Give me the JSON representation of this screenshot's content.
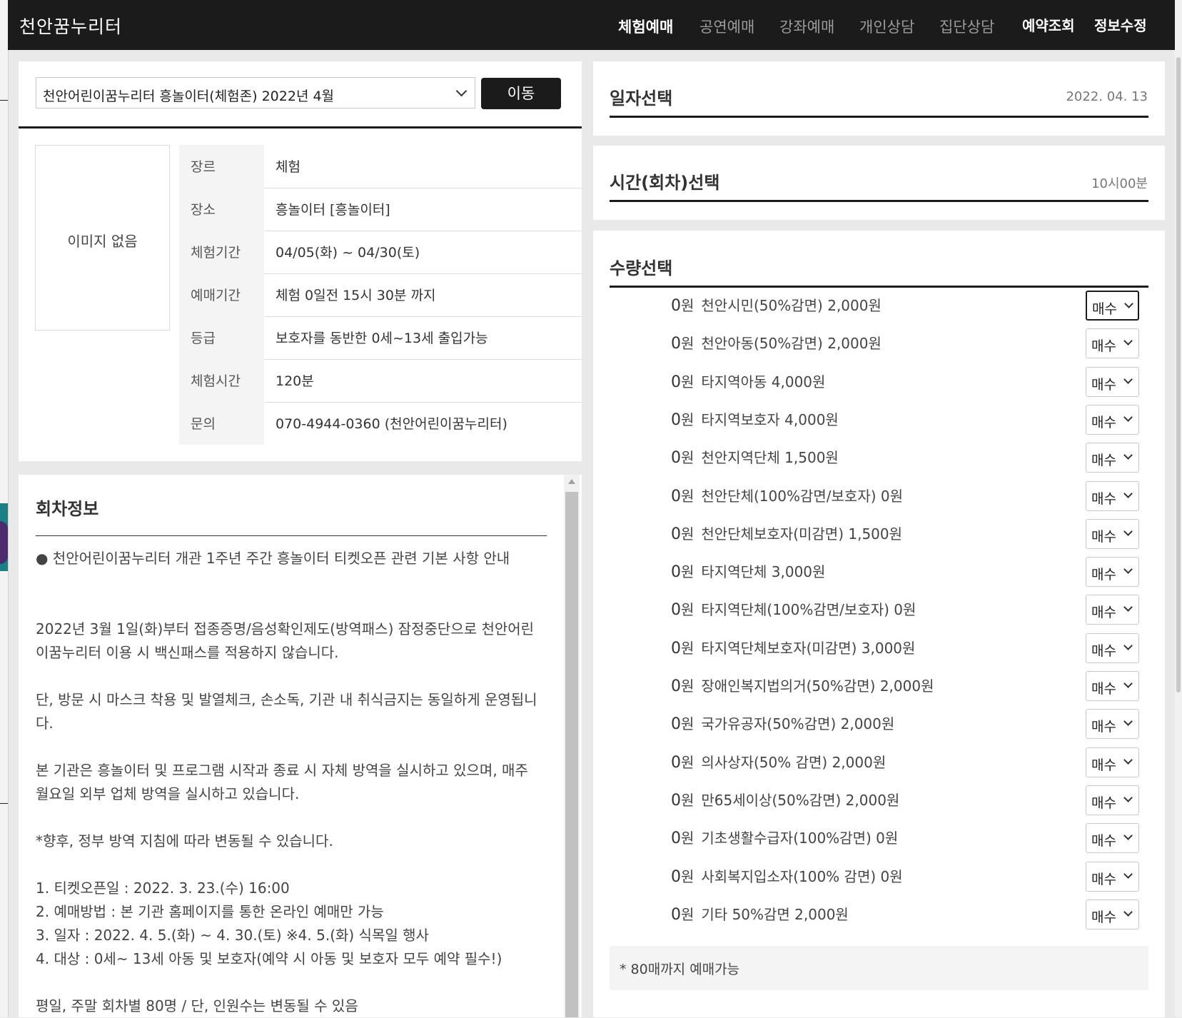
{
  "header": {
    "brand": "천안꿈누리터",
    "nav": [
      "체험예매",
      "공연예매",
      "강좌예매",
      "개인상담",
      "집단상담"
    ],
    "util": [
      "예약조회",
      "정보수정"
    ]
  },
  "program_select": {
    "selected": "천안어린이꿈누리터 흥놀이터(체험존) 2022년 4월",
    "go_label": "이동"
  },
  "no_image": "이미지 없음",
  "info": [
    {
      "label": "장르",
      "value": "체험"
    },
    {
      "label": "장소",
      "value": "흥놀이터 [흥놀이터]"
    },
    {
      "label": "체험기간",
      "value": "04/05(화) ~ 04/30(토)"
    },
    {
      "label": "예매기간",
      "value": "체험 0일전 15시 30분 까지"
    },
    {
      "label": "등급",
      "value": "보호자를 동반한 0세~13세 출입가능"
    },
    {
      "label": "체험시간",
      "value": "120분"
    },
    {
      "label": "문의",
      "value": "070-4944-0360 (천안어린이꿈누리터)"
    }
  ],
  "notice": {
    "title": "회차정보",
    "p1": "● 천안어린이꿈누리터 개관 1주년 주간 흥놀이터 티켓오픈 관련 기본 사항 안내",
    "p2": "2022년 3월 1일(화)부터 접종증명/음성확인제도(방역패스) 잠정중단으로 천안어린이꿈누리터 이용 시 백신패스를 적용하지 않습니다.",
    "p3": "단, 방문 시 마스크 착용 및 발열체크, 손소독, 기관 내 취식금지는 동일하게 운영됩니다.",
    "p4": "본 기관은 흥놀이터 및 프로그램 시작과 종료 시 자체 방역을 실시하고 있으며, 매주 월요일 외부 업체 방역을 실시하고 있습니다.",
    "p5": "*향후, 정부 방역 지침에 따라 변동될 수 있습니다.",
    "l1": "1. 티켓오픈일 : 2022. 3. 23.(수) 16:00",
    "l2": "2. 예매방법 : 본 기관 홈페이지를 통한 온라인 예매만 가능",
    "l3": "3. 일자 : 2022. 4. 5.(화) ~ 4. 30.(토) ※4. 5.(화) 식목일 행사",
    "l4": "4. 대상 : 0세~ 13세 아동 및 보호자(예약 시 아동 및 보호자 모두 예약 필수!)",
    "l5": "평일, 주말 회차별 80명 / 단, 인원수는 변동될 수 있음"
  },
  "date_select": {
    "title": "일자선택",
    "value": "2022. 04. 13"
  },
  "time_select": {
    "title": "시간(회차)선택",
    "value": "10시00분"
  },
  "qty_select": {
    "title": "수량선택",
    "select_label": "매수",
    "tickets": [
      {
        "price": "0",
        "unit": "원",
        "name": "천안시민(50%감면) 2,000원"
      },
      {
        "price": "0",
        "unit": "원",
        "name": "천안아동(50%감면) 2,000원"
      },
      {
        "price": "0",
        "unit": "원",
        "name": "타지역아동 4,000원"
      },
      {
        "price": "0",
        "unit": "원",
        "name": "타지역보호자 4,000원"
      },
      {
        "price": "0",
        "unit": "원",
        "name": "천안지역단체 1,500원"
      },
      {
        "price": "0",
        "unit": "원",
        "name": "천안단체(100%감면/보호자) 0원"
      },
      {
        "price": "0",
        "unit": "원",
        "name": "천안단체보호자(미감면) 1,500원"
      },
      {
        "price": "0",
        "unit": "원",
        "name": "타지역단체 3,000원"
      },
      {
        "price": "0",
        "unit": "원",
        "name": "타지역단체(100%감면/보호자) 0원"
      },
      {
        "price": "0",
        "unit": "원",
        "name": "타지역단체보호자(미감면) 3,000원"
      },
      {
        "price": "0",
        "unit": "원",
        "name": "장애인복지법의거(50%감면) 2,000원"
      },
      {
        "price": "0",
        "unit": "원",
        "name": "국가유공자(50%감면) 2,000원"
      },
      {
        "price": "0",
        "unit": "원",
        "name": "의사상자(50% 감면) 2,000원"
      },
      {
        "price": "0",
        "unit": "원",
        "name": "만65세이상(50%감면) 2,000원"
      },
      {
        "price": "0",
        "unit": "원",
        "name": "기초생활수급자(100%감면) 0원"
      },
      {
        "price": "0",
        "unit": "원",
        "name": "사회복지입소자(100% 감면) 0원"
      },
      {
        "price": "0",
        "unit": "원",
        "name": "기타 50%감면 2,000원"
      }
    ],
    "note": "* 80매까지 예매가능"
  }
}
